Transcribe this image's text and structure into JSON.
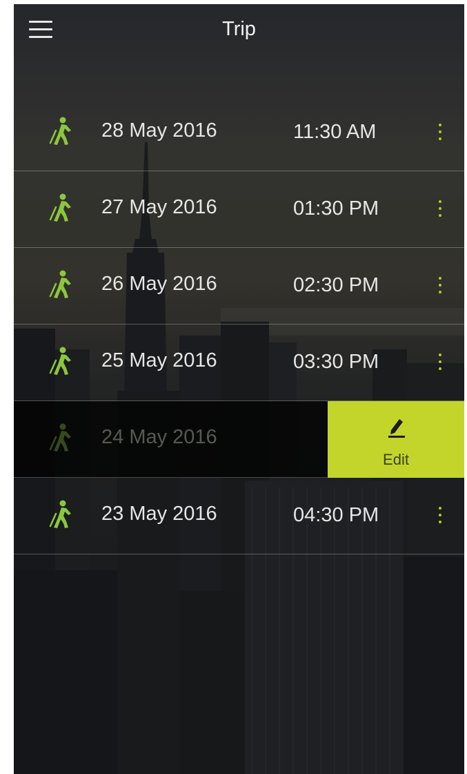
{
  "header": {
    "title": "Trip",
    "menu_icon": "hamburger-menu-icon"
  },
  "colors": {
    "accent": "#C3D52A",
    "walker_icon": "#8CC63F"
  },
  "trips": [
    {
      "date": "28 May 2016",
      "time": "11:30 AM",
      "icon": "walking-person-icon"
    },
    {
      "date": "27 May 2016",
      "time": "01:30 PM",
      "icon": "walking-person-icon"
    },
    {
      "date": "26 May 2016",
      "time": "02:30 PM",
      "icon": "walking-person-icon"
    },
    {
      "date": "25 May 2016",
      "time": "03:30 PM",
      "icon": "walking-person-icon"
    },
    {
      "date": "24 May 2016",
      "icon": "walking-person-icon",
      "swiped": true,
      "action_label": "Edit",
      "action_icon": "pencil-icon"
    },
    {
      "date": "23 May 2016",
      "time": "04:30 PM",
      "icon": "walking-person-icon"
    }
  ]
}
